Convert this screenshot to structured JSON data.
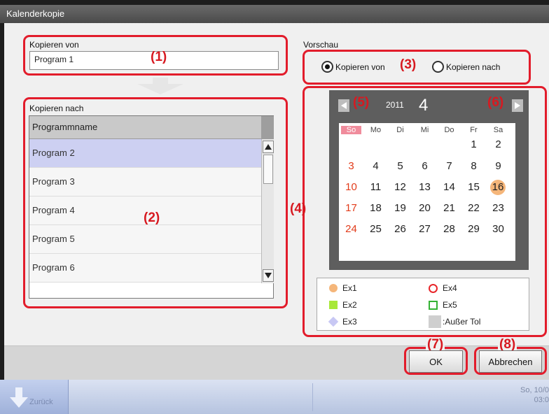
{
  "window": {
    "title": "Kalenderkopie"
  },
  "copy_from": {
    "label": "Kopieren von",
    "value": "Program 1"
  },
  "copy_to": {
    "label": "Kopieren nach",
    "column_header": "Programmname",
    "rows": [
      "Program 2",
      "Program 3",
      "Program 4",
      "Program 5",
      "Program 6"
    ],
    "selected_row": "Program 2"
  },
  "preview": {
    "label": "Vorschau",
    "radio_from": "Kopieren von",
    "radio_to": "Kopieren nach",
    "selected": "Kopieren von"
  },
  "calendar": {
    "year": "2011",
    "month": "4",
    "weekdays": [
      "So",
      "Mo",
      "Di",
      "Mi",
      "Do",
      "Fr",
      "Sa"
    ],
    "weeks": [
      [
        "",
        "",
        "",
        "",
        "",
        "1",
        "2"
      ],
      [
        "3",
        "4",
        "5",
        "6",
        "7",
        "8",
        "9"
      ],
      [
        "10",
        "11",
        "12",
        "13",
        "14",
        "15",
        "16"
      ],
      [
        "17",
        "18",
        "19",
        "20",
        "21",
        "22",
        "23"
      ],
      [
        "24",
        "25",
        "26",
        "27",
        "28",
        "29",
        "30"
      ]
    ],
    "highlighted_day": "16"
  },
  "legend": {
    "ex1": "Ex1",
    "ex2": "Ex2",
    "ex3": "Ex3",
    "ex4": "Ex4",
    "ex5": "Ex5",
    "out": ":Außer Tol"
  },
  "colors": {
    "ex1": "#f5b67a",
    "ex2": "#a8e838",
    "ex3": "#c8c8f4",
    "ex4": "#e8262a",
    "ex5": "#34b234",
    "out": "#cfcfcf",
    "callout": "#e21c2b"
  },
  "callouts": [
    "(1)",
    "(2)",
    "(3)",
    "(4)",
    "(5)",
    "(6)",
    "(7)",
    "(8)"
  ],
  "buttons": {
    "ok": "OK",
    "cancel": "Abbrechen"
  },
  "taskbar": {
    "start_label": "Zurück",
    "clock_date": "So, 10/0",
    "clock_time": "03:0"
  },
  "icons": [
    "arrow-down-icon",
    "scroll-up-icon",
    "scroll-down-icon",
    "prev-month-icon",
    "next-month-icon",
    "start-arrow-icon"
  ]
}
